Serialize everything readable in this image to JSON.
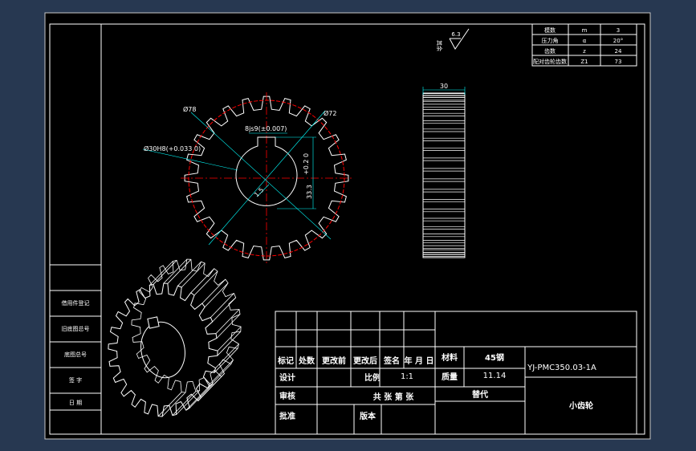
{
  "colors": {
    "background": "#273851",
    "paper": "#000000",
    "lines": "#ffffff",
    "dimension": "#00ffff",
    "section": "#ff0000",
    "dim_text": "#00ff00"
  },
  "gear_params": {
    "rows": [
      {
        "label": "模数",
        "symbol": "m",
        "value": "3"
      },
      {
        "label": "压力角",
        "symbol": "α",
        "value": "20°"
      },
      {
        "label": "齿数",
        "symbol": "z",
        "value": "24"
      },
      {
        "label": "配对齿轮齿数",
        "symbol": "Z1",
        "value": "73"
      }
    ]
  },
  "surface": {
    "value": "6.3",
    "note": "其余"
  },
  "dims": {
    "outer_dia": "Ø78",
    "root_dia": "Ø72",
    "bore": "Ø30H8(+0.033 0)",
    "keyway_width": "8js9(±0.007)",
    "keyway_depth": "33.3",
    "keyway_tol": "+0.2 0",
    "chamfer": "1.5",
    "face_width": "30"
  },
  "left_column": {
    "items": [
      "借用件登记",
      "旧底图总号",
      "底图总号",
      "签 字",
      "日 期"
    ]
  },
  "title_block": {
    "header": [
      "标记",
      "处数",
      "更改前",
      "更改后",
      "签名",
      "年 月 日"
    ],
    "rows": [
      {
        "label": "设计"
      },
      {
        "label": "审核"
      },
      {
        "label": "批准"
      }
    ],
    "scale_label": "比例",
    "scale_value": "1:1",
    "sheet_info": "共 张 第 张",
    "version_label": "版本",
    "material_label": "材料",
    "material_value": "45钢",
    "weight_label": "质量",
    "weight_value": "11.14",
    "replace_label": "替代",
    "drawing_no": "YJ-PMC350.03-1A",
    "part_name": "小齿轮"
  }
}
